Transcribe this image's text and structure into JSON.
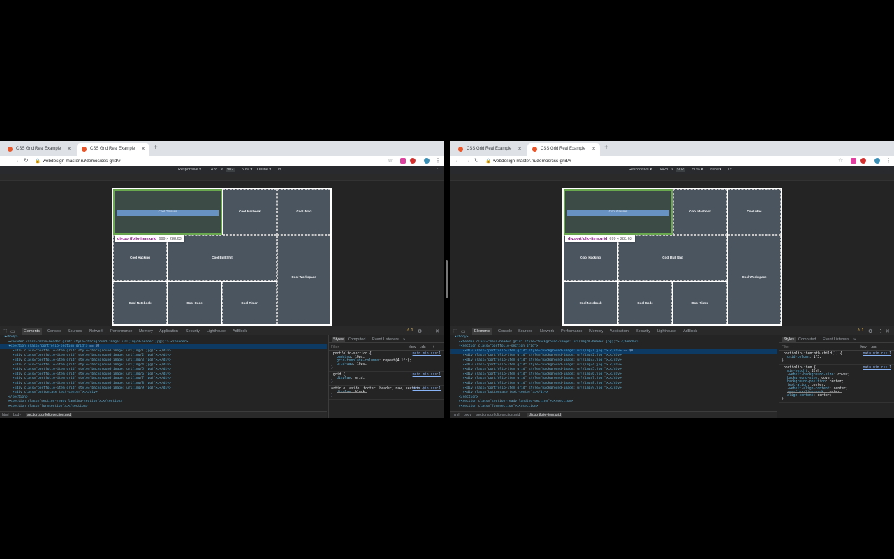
{
  "browser": {
    "tabs": [
      {
        "title": "CSS Grid Real Example",
        "active": false
      },
      {
        "title": "CSS Grid Real Example",
        "active": true
      }
    ],
    "url": "webdesign-master.ru/demos/css-grid/#"
  },
  "device_toolbar": {
    "mode": "Responsive ▾",
    "width": "1428",
    "times": "×",
    "height": "902",
    "zoom": "50% ▾",
    "network": "Online ▾"
  },
  "portfolio_items": [
    {
      "label": "Cool Glasses"
    },
    {
      "label": "Cool Macbook"
    },
    {
      "label": "Cool iMac"
    },
    {
      "label": "Cool Hacking"
    },
    {
      "label": "Cool Bull Shit"
    },
    {
      "label": "Cool Workspace"
    },
    {
      "label": "Cool Notebook"
    },
    {
      "label": "Cool Code"
    },
    {
      "label": "Cool Timer"
    }
  ],
  "tooltip": {
    "name": "div.portfolio-item.grid",
    "size": "699 × 288.63"
  },
  "devtools": {
    "tabs": [
      "Elements",
      "Console",
      "Sources",
      "Network",
      "Performance",
      "Memory",
      "Application",
      "Security",
      "Lighthouse",
      "AdBlock"
    ],
    "warning_count": "1",
    "styles_tabs": [
      "Styles",
      "Computed",
      "Event Listeners",
      "»"
    ],
    "filter_placeholder": "Filter",
    "hov": ":hov",
    "cls": ".cls",
    "plus": "+"
  },
  "elements_tree": [
    {
      "indent": 1,
      "text": "▾<body>"
    },
    {
      "indent": 2,
      "text": "▸<header class=\"main-header grid\" style=\"background-image: url(img/0-header.jpg);\">…</header>"
    },
    {
      "indent": 2,
      "text": "▾<section class=\"portfolio-section grid\">"
    },
    {
      "indent": 3,
      "text": "▸<div class=\"portfolio-item grid\" style=\"background-image: url(img/1.jpg)\">…</div>"
    },
    {
      "indent": 3,
      "text": "▸<div class=\"portfolio-item grid\" style=\"background-image: url(img/2.jpg)\">…</div>"
    },
    {
      "indent": 3,
      "text": "▸<div class=\"portfolio-item grid\" style=\"background-image: url(img/3.jpg)\">…</div>"
    },
    {
      "indent": 3,
      "text": "▸<div class=\"portfolio-item grid\" style=\"background-image: url(img/4.jpg)\">…</div>"
    },
    {
      "indent": 3,
      "text": "▸<div class=\"portfolio-item grid\" style=\"background-image: url(img/5.jpg)\">…</div>"
    },
    {
      "indent": 3,
      "text": "▸<div class=\"portfolio-item grid\" style=\"background-image: url(img/6.jpg)\">…</div>"
    },
    {
      "indent": 3,
      "text": "▸<div class=\"portfolio-item grid\" style=\"background-image: url(img/7.jpg)\">…</div>"
    },
    {
      "indent": 3,
      "text": "▸<div class=\"portfolio-item grid\" style=\"background-image: url(img/8.jpg)\">…</div>"
    },
    {
      "indent": 3,
      "text": "▸<div class=\"portfolio-item grid\" style=\"background-image: url(img/9.jpg)\">…</div>"
    },
    {
      "indent": 3,
      "text": "▸<div class=\"buttoncase text-center\">…</div>"
    },
    {
      "indent": 2,
      "text": "</section>"
    },
    {
      "indent": 2,
      "text": "▸<section class=\"section-ready landing-section\">…</section>"
    },
    {
      "indent": 2,
      "text": "▸<section class=\"formsection\">…</section>"
    }
  ],
  "left_panel": {
    "selected_index": 2,
    "selected_suffix": " == $0",
    "breadcrumbs": [
      "html",
      "body",
      "section.portfolio-section.grid"
    ],
    "style_rules": [
      {
        "selector": ".portfolio-section {",
        "source": "main.min.css:1",
        "props": [
          {
            "name": "padding",
            "value": "10px;",
            "struck": false
          },
          {
            "name": "grid-template-columns",
            "value": "repeat(4,1fr);",
            "struck": false
          },
          {
            "name": "grid-gap",
            "value": "10px;",
            "struck": false
          }
        ]
      },
      {
        "selector": ".grid {",
        "source": "main.min.css:1",
        "props": [
          {
            "name": "display",
            "value": "grid;",
            "struck": false
          }
        ]
      },
      {
        "selector": "article, aside, footer, header, nav, section {",
        "source": "main.min.css:1",
        "props": [
          {
            "name": "display",
            "value": "block;",
            "struck": true
          }
        ]
      }
    ]
  },
  "right_panel": {
    "selected_index": 3,
    "selected_suffix": " == $0",
    "breadcrumbs": [
      "html",
      "body",
      "section.portfolio-section.grid",
      "div.portfolio-item.grid"
    ],
    "style_rules": [
      {
        "selector": ".portfolio-item:nth-child(1) {",
        "source": "main.min.css:1",
        "props": [
          {
            "name": "grid-column",
            "value": "1/3;",
            "struck": false
          }
        ]
      },
      {
        "selector": ".portfolio-item {",
        "source": "main.min.css:1",
        "props": [
          {
            "name": "min-height",
            "value": "32vh;",
            "struck": false
          },
          {
            "name": "-webkit-background-size",
            "value": "cover;",
            "struck": true
          },
          {
            "name": "background-size",
            "value": "cover;",
            "struck": false
          },
          {
            "name": "background-position",
            "value": "center;",
            "struck": false
          },
          {
            "name": "text-align",
            "value": "center;",
            "struck": false
          },
          {
            "name": "-webkit-align-content",
            "value": "center;",
            "struck": true
          },
          {
            "name": "-ms-flex-line-pack",
            "value": "center;",
            "struck": true
          },
          {
            "name": "align-content",
            "value": "center;",
            "struck": false
          }
        ]
      }
    ]
  }
}
